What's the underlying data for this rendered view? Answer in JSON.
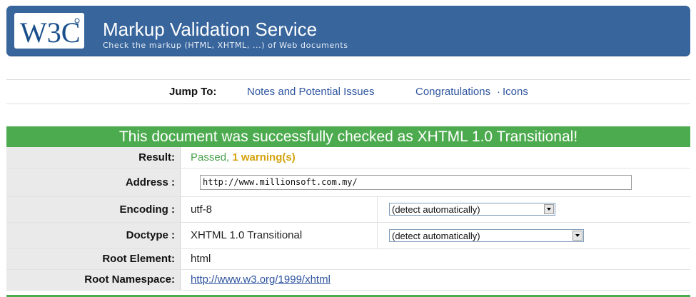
{
  "banner": {
    "logo_text": "W3C",
    "title": "Markup Validation Service",
    "subtitle": "Check the markup (HTML, XHTML, ...) of Web documents"
  },
  "jump": {
    "label": "Jump To:",
    "links": [
      "Notes and Potential Issues",
      "Congratulations",
      "Icons"
    ],
    "separator": "·"
  },
  "success": {
    "message": "This document was successfully checked as XHTML 1.0 Transitional!"
  },
  "results": {
    "result_label": "Result:",
    "result_passed": "Passed,",
    "result_warning": "1 warning(s)",
    "address_label": "Address :",
    "address_value": "http://www.millionsoft.com.my/",
    "encoding_label": "Encoding :",
    "encoding_value": "utf-8",
    "encoding_select": "(detect automatically)",
    "doctype_label": "Doctype :",
    "doctype_value": "XHTML 1.0 Transitional",
    "doctype_select": "(detect automatically)",
    "root_label": "Root Element:",
    "root_value": "html",
    "ns_label": "Root Namespace:",
    "ns_value": "http://www.w3.org/1999/xhtml"
  },
  "colors": {
    "banner": "#37659c",
    "success": "#4cab4e",
    "link": "#2f55a0",
    "warning": "#d4a30d"
  }
}
